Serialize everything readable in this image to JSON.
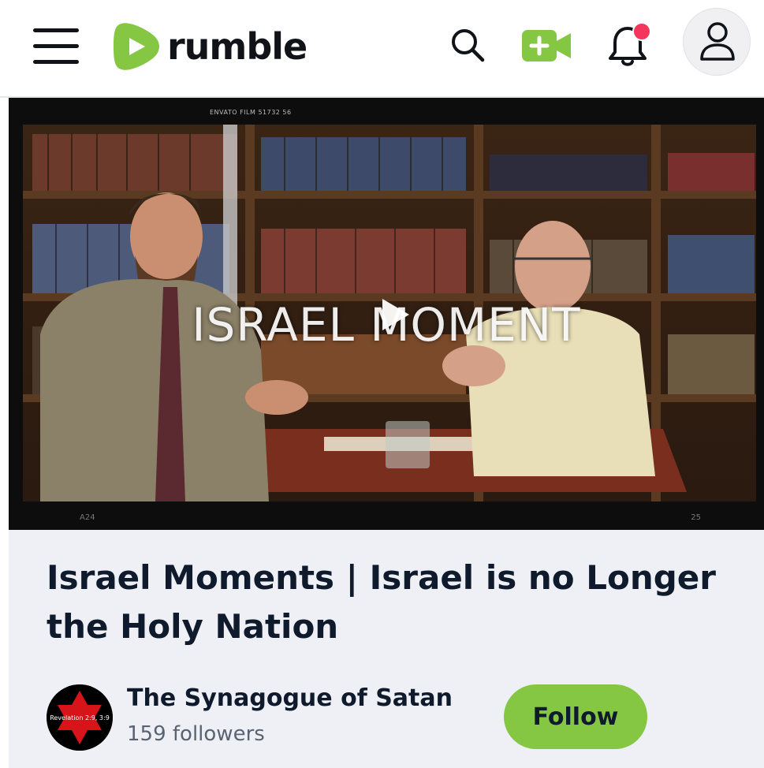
{
  "header": {
    "logo_text": "rumble",
    "menu_icon": "hamburger-menu-icon",
    "search_icon": "search-icon",
    "upload_icon": "video-camera-plus-icon",
    "notification_icon": "bell-icon",
    "profile_icon": "user-icon",
    "brand_color": "#85c742",
    "notification_dot_color": "#f5365c"
  },
  "video": {
    "watermark": "ENVATO FILM 51732 56",
    "overlay_title": "ISRAEL MOMENT",
    "corner_left": "A24",
    "corner_right": "25",
    "play_icon": "play-icon"
  },
  "info": {
    "title": "Israel Moments | Israel is no Longer the Holy Nation",
    "channel": {
      "name": "The Synagogue of Satan",
      "followers": "159 followers",
      "avatar_text": "Revelation 2:9, 3:9",
      "avatar_icon": "star-of-david-icon"
    },
    "follow_label": "Follow"
  }
}
